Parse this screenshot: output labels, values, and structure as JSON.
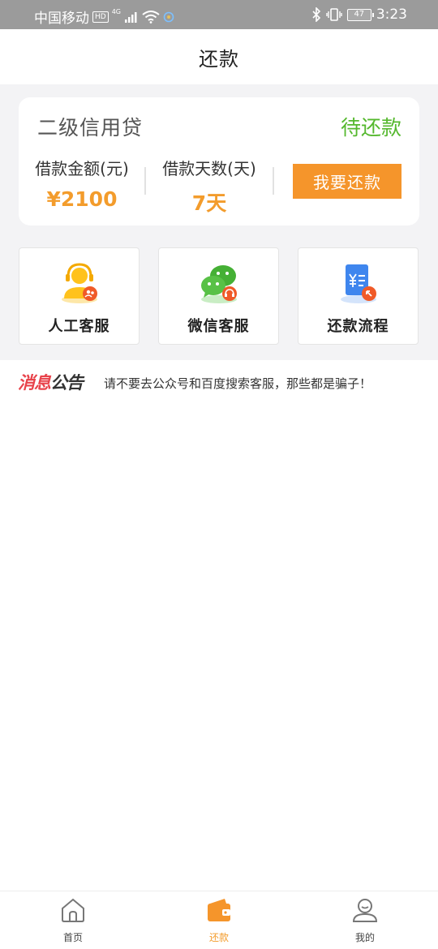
{
  "status_bar": {
    "carrier": "中国移动",
    "hd_badge": "HD",
    "network": "4G",
    "battery": "47",
    "time": "3:23",
    "icons": [
      "signal-icon",
      "wifi-icon",
      "bluetooth-icon",
      "vibrate-icon",
      "battery-icon"
    ]
  },
  "header": {
    "title": "还款"
  },
  "loan_card": {
    "name": "二级信用贷",
    "status": "待还款",
    "amount_label": "借款金额(元)",
    "amount_value": "¥2100",
    "days_label": "借款天数(天)",
    "days_value": "7天",
    "repay_button": "我要还款"
  },
  "services": [
    {
      "label": "人工客服",
      "icon": "customer-service-icon"
    },
    {
      "label": "微信客服",
      "icon": "wechat-icon"
    },
    {
      "label": "还款流程",
      "icon": "repayment-process-icon"
    }
  ],
  "notice": {
    "badge_part1": "消息",
    "badge_part2": "公告",
    "text": "请不要去公众号和百度搜索客服，那些都是骗子！"
  },
  "bottom_nav": [
    {
      "label": "首页",
      "icon": "home-icon",
      "active": false
    },
    {
      "label": "还款",
      "icon": "wallet-icon",
      "active": true
    },
    {
      "label": "我的",
      "icon": "user-icon",
      "active": false
    }
  ],
  "colors": {
    "accent_orange": "#f5952b",
    "status_green": "#55b82e",
    "notice_red": "#e8434b",
    "background_gray": "#f3f3f5"
  }
}
